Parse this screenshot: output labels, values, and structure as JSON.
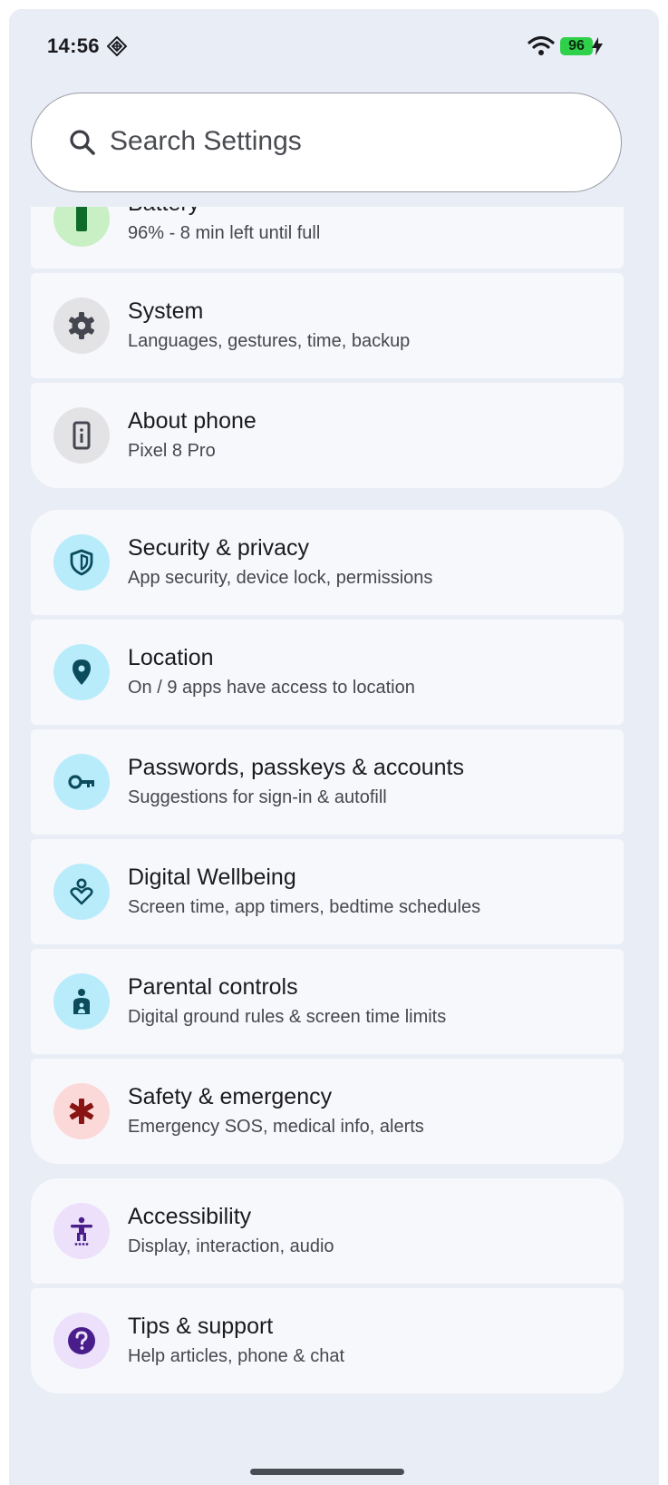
{
  "status_bar": {
    "time": "14:56",
    "battery_level": "96",
    "notification_icon": "diamond-grid-icon",
    "wifi_icon": "wifi-icon",
    "charging_icon": "bolt-icon"
  },
  "search": {
    "placeholder": "Search Settings",
    "icon": "search-icon"
  },
  "groups": [
    {
      "items": [
        {
          "title": "Battery",
          "subtitle": "96% - 8 min left until full",
          "icon": "battery-icon",
          "color": "#c8f0c4"
        },
        {
          "title": "System",
          "subtitle": "Languages, gestures, time, backup",
          "icon": "gear-icon",
          "color": "#e3e3e6"
        },
        {
          "title": "About phone",
          "subtitle": "Pixel 8 Pro",
          "icon": "phone-info-icon",
          "color": "#e3e3e6"
        }
      ]
    },
    {
      "items": [
        {
          "title": "Security & privacy",
          "subtitle": "App security, device lock, permissions",
          "icon": "shield-icon",
          "color": "#b9ecfb"
        },
        {
          "title": "Location",
          "subtitle": "On / 9 apps have access to location",
          "icon": "location-pin-icon",
          "color": "#b9ecfb"
        },
        {
          "title": "Passwords, passkeys & accounts",
          "subtitle": "Suggestions for sign-in & autofill",
          "icon": "key-icon",
          "color": "#b9ecfb"
        },
        {
          "title": "Digital Wellbeing",
          "subtitle": "Screen time, app timers, bedtime schedules",
          "icon": "wellbeing-heart-icon",
          "color": "#b9ecfb"
        },
        {
          "title": "Parental controls",
          "subtitle": "Digital ground rules & screen time limits",
          "icon": "parent-child-icon",
          "color": "#b9ecfb"
        },
        {
          "title": "Safety & emergency",
          "subtitle": "Emergency SOS, medical info, alerts",
          "icon": "medical-asterisk-icon",
          "color": "#fbd9d9"
        }
      ]
    },
    {
      "items": [
        {
          "title": "Accessibility",
          "subtitle": "Display, interaction, audio",
          "icon": "accessibility-person-icon",
          "color": "#ece0fb"
        },
        {
          "title": "Tips & support",
          "subtitle": "Help articles, phone & chat",
          "icon": "help-question-icon",
          "color": "#ece0fb"
        }
      ]
    }
  ]
}
